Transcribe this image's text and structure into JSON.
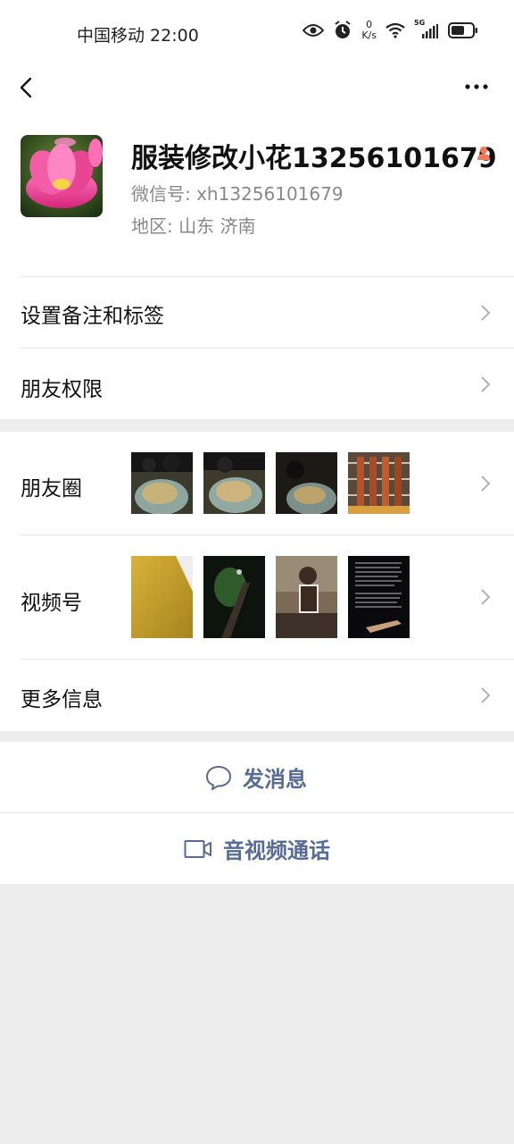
{
  "status_bar": {
    "carrier_time": "中国移动 22:00",
    "net_speed_value": "0",
    "net_speed_unit": "K/s",
    "network_label": "5G",
    "icons": [
      "eye-icon",
      "alarm-icon",
      "wifi-icon",
      "signal-icon",
      "battery-icon"
    ]
  },
  "profile": {
    "name": "服装修改小花13256101679",
    "wechat_id": "微信号: xh13256101679",
    "region": "地区: 山东  济南"
  },
  "menu": {
    "remark_tags": "设置备注和标签",
    "friend_permissions": "朋友权限",
    "moments": "朋友圈",
    "channels": "视频号",
    "more_info": "更多信息"
  },
  "actions": {
    "send_message": "发消息",
    "av_call": "音视频通话"
  },
  "colors": {
    "link": "#576b95",
    "background": "#ededed",
    "divider": "#e5e5e5"
  }
}
